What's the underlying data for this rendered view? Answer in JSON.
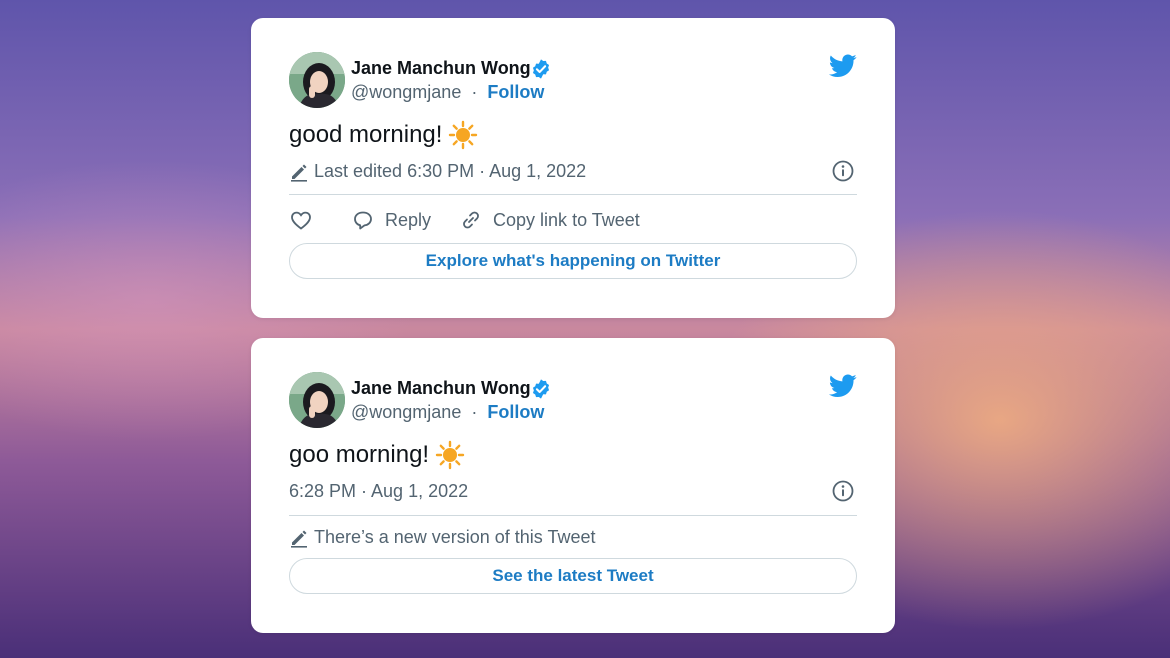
{
  "tweets": [
    {
      "author_name": "Jane Manchun Wong",
      "handle": "@wongmjane",
      "separator": "·",
      "follow_label": "Follow",
      "text": "good morning!",
      "emoji": "sun-emoji",
      "meta_text": "Last edited 6:30 PM · Aug 1, 2022",
      "actions": {
        "reply_label": "Reply",
        "copy_link_label": "Copy link to Tweet"
      },
      "cta_label": "Explore what's happening on Twitter"
    },
    {
      "author_name": "Jane Manchun Wong",
      "handle": "@wongmjane",
      "separator": "·",
      "follow_label": "Follow",
      "text": "goo morning!",
      "emoji": "sun-emoji",
      "meta_text": "6:28 PM · Aug 1, 2022",
      "notice_text": "There’s a new version of this Tweet",
      "cta_label": "See the latest Tweet"
    }
  ],
  "colors": {
    "accent": "#1d7cc4",
    "twitter_blue": "#1d9bf0",
    "text_primary": "#0f1419",
    "text_secondary": "#536471",
    "divider": "#cfd9de",
    "sun": "#f6a623"
  },
  "icons": [
    "verified-badge-icon",
    "twitter-bird-icon",
    "pencil-icon",
    "info-icon",
    "heart-icon",
    "reply-icon",
    "link-icon",
    "sun-emoji"
  ]
}
